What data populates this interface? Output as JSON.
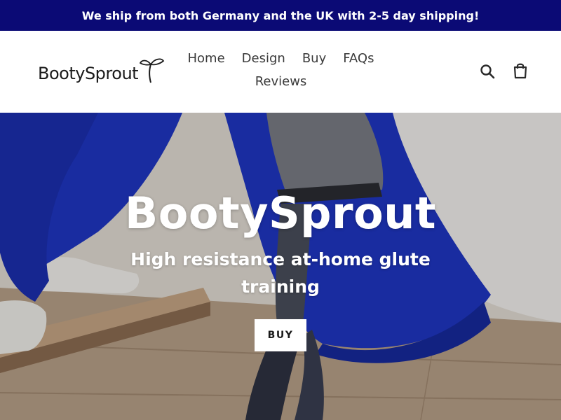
{
  "announcement": {
    "text": "We ship from both Germany and the UK with 2-5 day shipping!"
  },
  "header": {
    "logo_text": "BootySprout",
    "nav": [
      {
        "label": "Home"
      },
      {
        "label": "Design"
      },
      {
        "label": "Buy"
      },
      {
        "label": "FAQs"
      },
      {
        "label": "Reviews"
      }
    ],
    "icons": [
      "search-icon",
      "cart-icon"
    ]
  },
  "hero": {
    "title": "BootySprout",
    "subtitle": "High resistance at-home glute training",
    "button_label": "BUY"
  },
  "colors": {
    "announcement_bg": "#0b0a75",
    "announcement_text": "#ffffff",
    "nav_text": "#3a3a3a",
    "hero_text": "#ffffff",
    "button_bg": "#ffffff",
    "pants_blue": "#1f36c4"
  }
}
